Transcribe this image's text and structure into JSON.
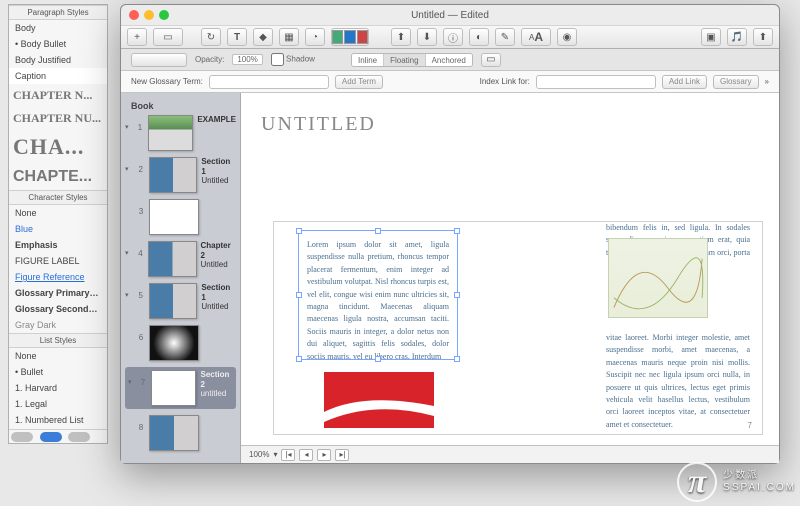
{
  "left_panel": {
    "headers": {
      "para": "Paragraph Styles",
      "char": "Character Styles",
      "list": "List Styles"
    },
    "paragraph": [
      "Body",
      "• Body Bullet",
      "Body Justified",
      "Caption"
    ],
    "chapter_styles": [
      "CHAPTER N...",
      "CHAPTER NU...",
      "CHA...",
      "CHAPTE..."
    ],
    "character": [
      "None",
      "Blue",
      "Emphasis",
      "FIGURE LABEL",
      "Figure Reference",
      "Glossary Primary Def...",
      "Glossary Secondary ...",
      "Gray Dark"
    ],
    "list": [
      "None",
      "• Bullet",
      "1. Harvard",
      "1. Legal",
      "1. Numbered List"
    ]
  },
  "window": {
    "title": "Untitled — Edited",
    "optbar": {
      "opacity_label": "Opacity:",
      "opacity_val": "100%",
      "shadow": "Shadow",
      "segments": [
        "Inline",
        "Floating",
        "Anchored"
      ]
    },
    "glossary": {
      "label": "New Glossary Term:",
      "add": "Add Term",
      "index": "Index Link for:",
      "addlink": "Add Link",
      "gbtn": "Glossary"
    },
    "thumbs": {
      "header": "Book",
      "rows": [
        {
          "n": "1",
          "label_b": "EXAMPLE",
          "label": "",
          "type": "land"
        },
        {
          "n": "2",
          "label_b": "Section 1",
          "label": "Untitled",
          "type": "photo"
        },
        {
          "n": "3",
          "label_b": "",
          "label": "",
          "type": "txt"
        },
        {
          "n": "4",
          "label_b": "Chapter 2",
          "label": "Untitled",
          "type": "photo"
        },
        {
          "n": "5",
          "label_b": "Section 1",
          "label": "Untitled",
          "type": "photo"
        },
        {
          "n": "6",
          "label_b": "",
          "label": "",
          "type": "dark"
        },
        {
          "n": "7",
          "label_b": "Section 2",
          "label": "untitled",
          "type": "sel",
          "white": true
        },
        {
          "n": "8",
          "label_b": "",
          "label": "",
          "type": "photo"
        }
      ]
    },
    "doc": {
      "title": "UNTITLED",
      "selected_text": "Lorem ipsum dolor sit amet, ligula suspendisse nulla pretium, rhoncus tempor placerat fermentum, enim integer ad vestibulum volutpat. Nisl rhoncus turpis est, vel elit, congue wisi enim nunc ultricies sit, magna tincidunt. Maecenas aliquam maecenas ligula nostra, accumsan taciti. Sociis mauris in integer, a dolor netus non dui aliquet, sagittis felis sodales, dolor sociis mauris, vel eu libero cras. Interdum",
      "right_top": "bibendum felis in, sed ligula. In sodales suspendisse mauris quam etiam erat, quia tellus convallis eros rhoncus diam orci, porta lectus esse adipiscing posuere et, nisl arcu",
      "right_bottom": "vitae laoreet. Morbi integer molestie, amet suspendisse morbi, amet maecenas, a maecenas mauris neque proin nisi mollis. Suscipit nec nec ligula ipsum orci nulla, in posuere ut quis ultrices, lectus eget primis vehicula velit hasellus lectus, vestibulum orci laoreet inceptos vitae, at consectetuer amet et consectetuer.",
      "page": "7"
    },
    "zoom": "100%"
  },
  "watermark": {
    "big": "少数派",
    "small": "SSPAI.COM"
  }
}
